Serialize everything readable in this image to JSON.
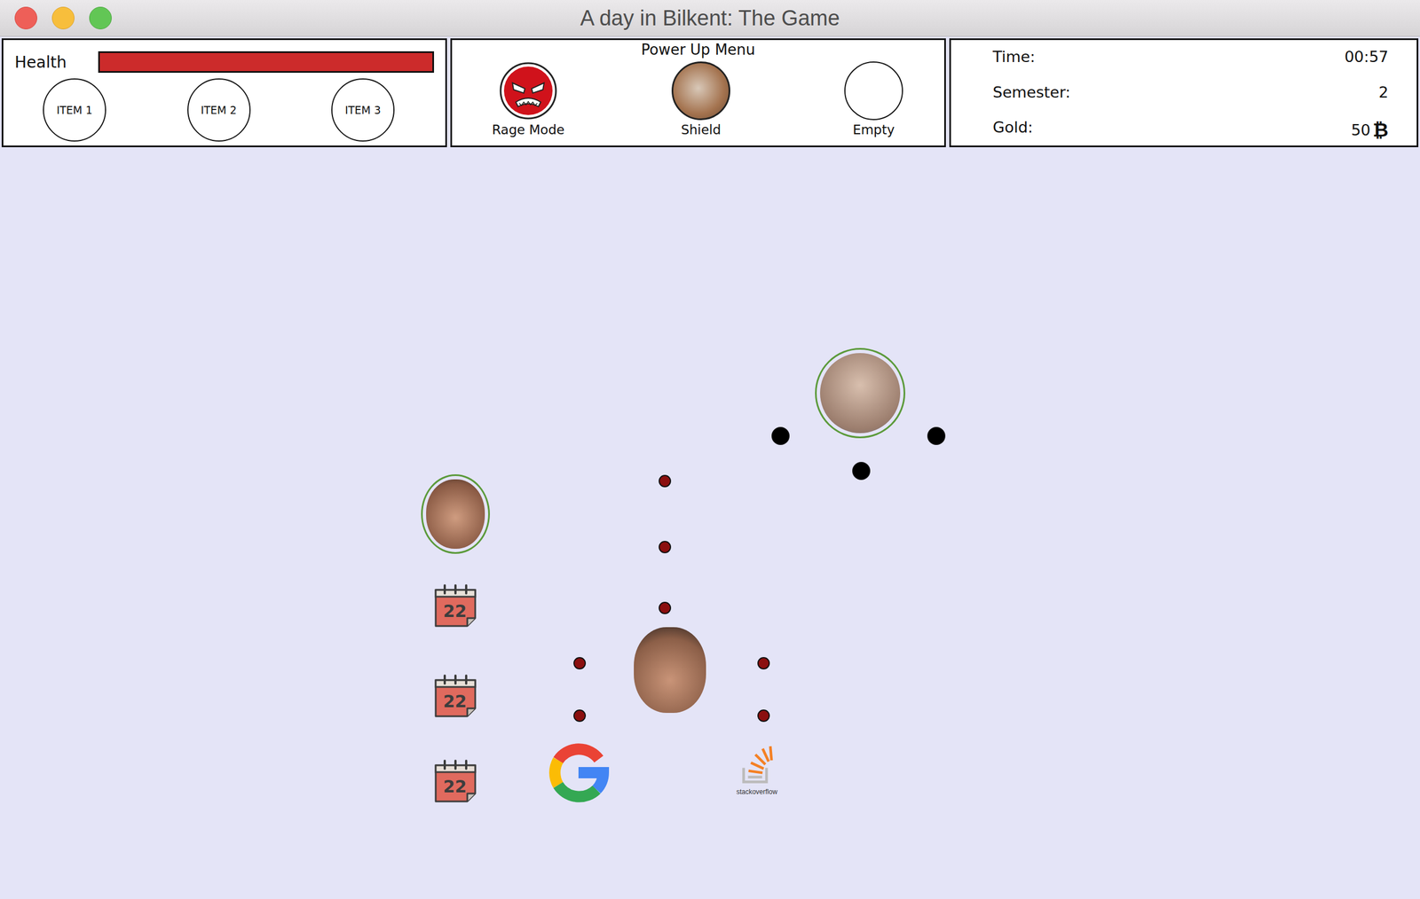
{
  "window": {
    "title": "A day in Bilkent: The Game"
  },
  "health": {
    "label": "Health",
    "level": 1
  },
  "items": [
    {
      "label": "ITEM 1"
    },
    {
      "label": "ITEM 2"
    },
    {
      "label": "ITEM 3"
    }
  ],
  "power_up_menu": {
    "title": "Power Up Menu",
    "power_ups": [
      {
        "label": "Rage Mode",
        "kind": "rage"
      },
      {
        "label": "Shield",
        "kind": "shield"
      },
      {
        "label": "Empty",
        "kind": "empty"
      }
    ]
  },
  "stats": [
    {
      "label": "Time:",
      "value": "00:57"
    },
    {
      "label": "Semester:",
      "value": "2"
    },
    {
      "label": "Gold:",
      "value": "50",
      "unit": "₿"
    }
  ],
  "board": {
    "characters": [
      {
        "kind": "boss"
      },
      {
        "kind": "enemy"
      },
      {
        "kind": "player"
      }
    ],
    "pickups": [
      {
        "kind": "calendar",
        "label": "22"
      },
      {
        "kind": "calendar",
        "label": "22"
      },
      {
        "kind": "calendar",
        "label": "22"
      },
      {
        "kind": "google"
      },
      {
        "kind": "stackoverflow",
        "label": "stackoverflow"
      }
    ],
    "shots": [
      {
        "color": "#000000"
      },
      {
        "color": "#000000"
      },
      {
        "color": "#000000"
      },
      {
        "color": "#8b0f0f"
      },
      {
        "color": "#8b0f0f"
      },
      {
        "color": "#8b0f0f"
      },
      {
        "color": "#8b0f0f"
      },
      {
        "color": "#8b0f0f"
      },
      {
        "color": "#8b0f0f"
      },
      {
        "color": "#8b0f0f"
      }
    ]
  }
}
